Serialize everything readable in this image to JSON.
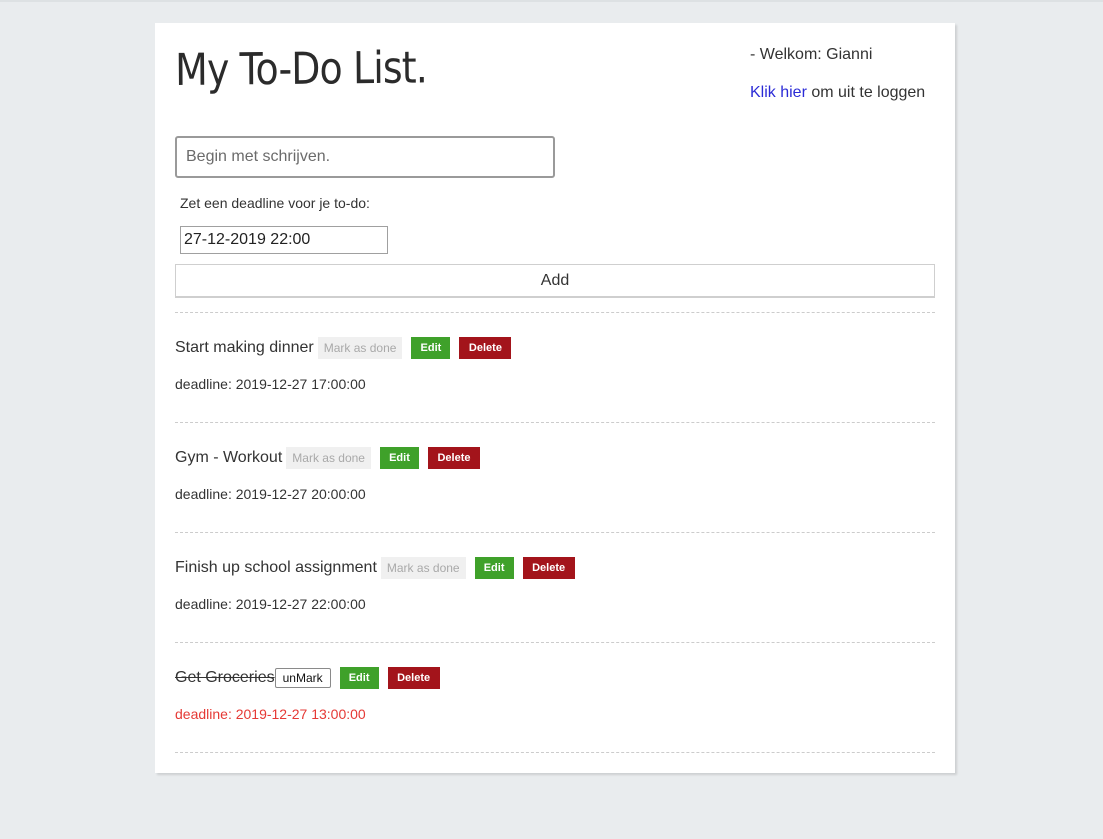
{
  "header": {
    "title": "My To-Do List.",
    "welcome": "- Welkom: Gianni",
    "logout_link": "Klik hier",
    "logout_suffix": " om uit te loggen"
  },
  "form": {
    "todo_placeholder": "Begin met schrijven.",
    "todo_value": "",
    "deadline_label": "Zet een deadline voor je to-do:",
    "deadline_value": "27-12-2019 22:00",
    "add_label": "Add"
  },
  "todos": [
    {
      "text": "Start making dinner",
      "done": false,
      "action_label": "Mark as done",
      "edit_label": "Edit",
      "delete_label": "Delete",
      "deadline": "deadline: 2019-12-27 17:00:00"
    },
    {
      "text": "Gym - Workout",
      "done": false,
      "action_label": "Mark as done",
      "edit_label": "Edit",
      "delete_label": "Delete",
      "deadline": "deadline: 2019-12-27 20:00:00"
    },
    {
      "text": "Finish up school assignment",
      "done": false,
      "action_label": "Mark as done",
      "edit_label": "Edit",
      "delete_label": "Delete",
      "deadline": "deadline: 2019-12-27 22:00:00"
    },
    {
      "text": "Get Groceries",
      "done": true,
      "action_label": "unMark",
      "edit_label": "Edit",
      "delete_label": "Delete",
      "deadline": "deadline: 2019-12-27 13:00:00"
    }
  ],
  "colors": {
    "background": "#e9ecee",
    "edit": "#3fa12a",
    "delete": "#a3141b",
    "link": "#2b2bd6",
    "overdue_deadline": "#e53935"
  }
}
